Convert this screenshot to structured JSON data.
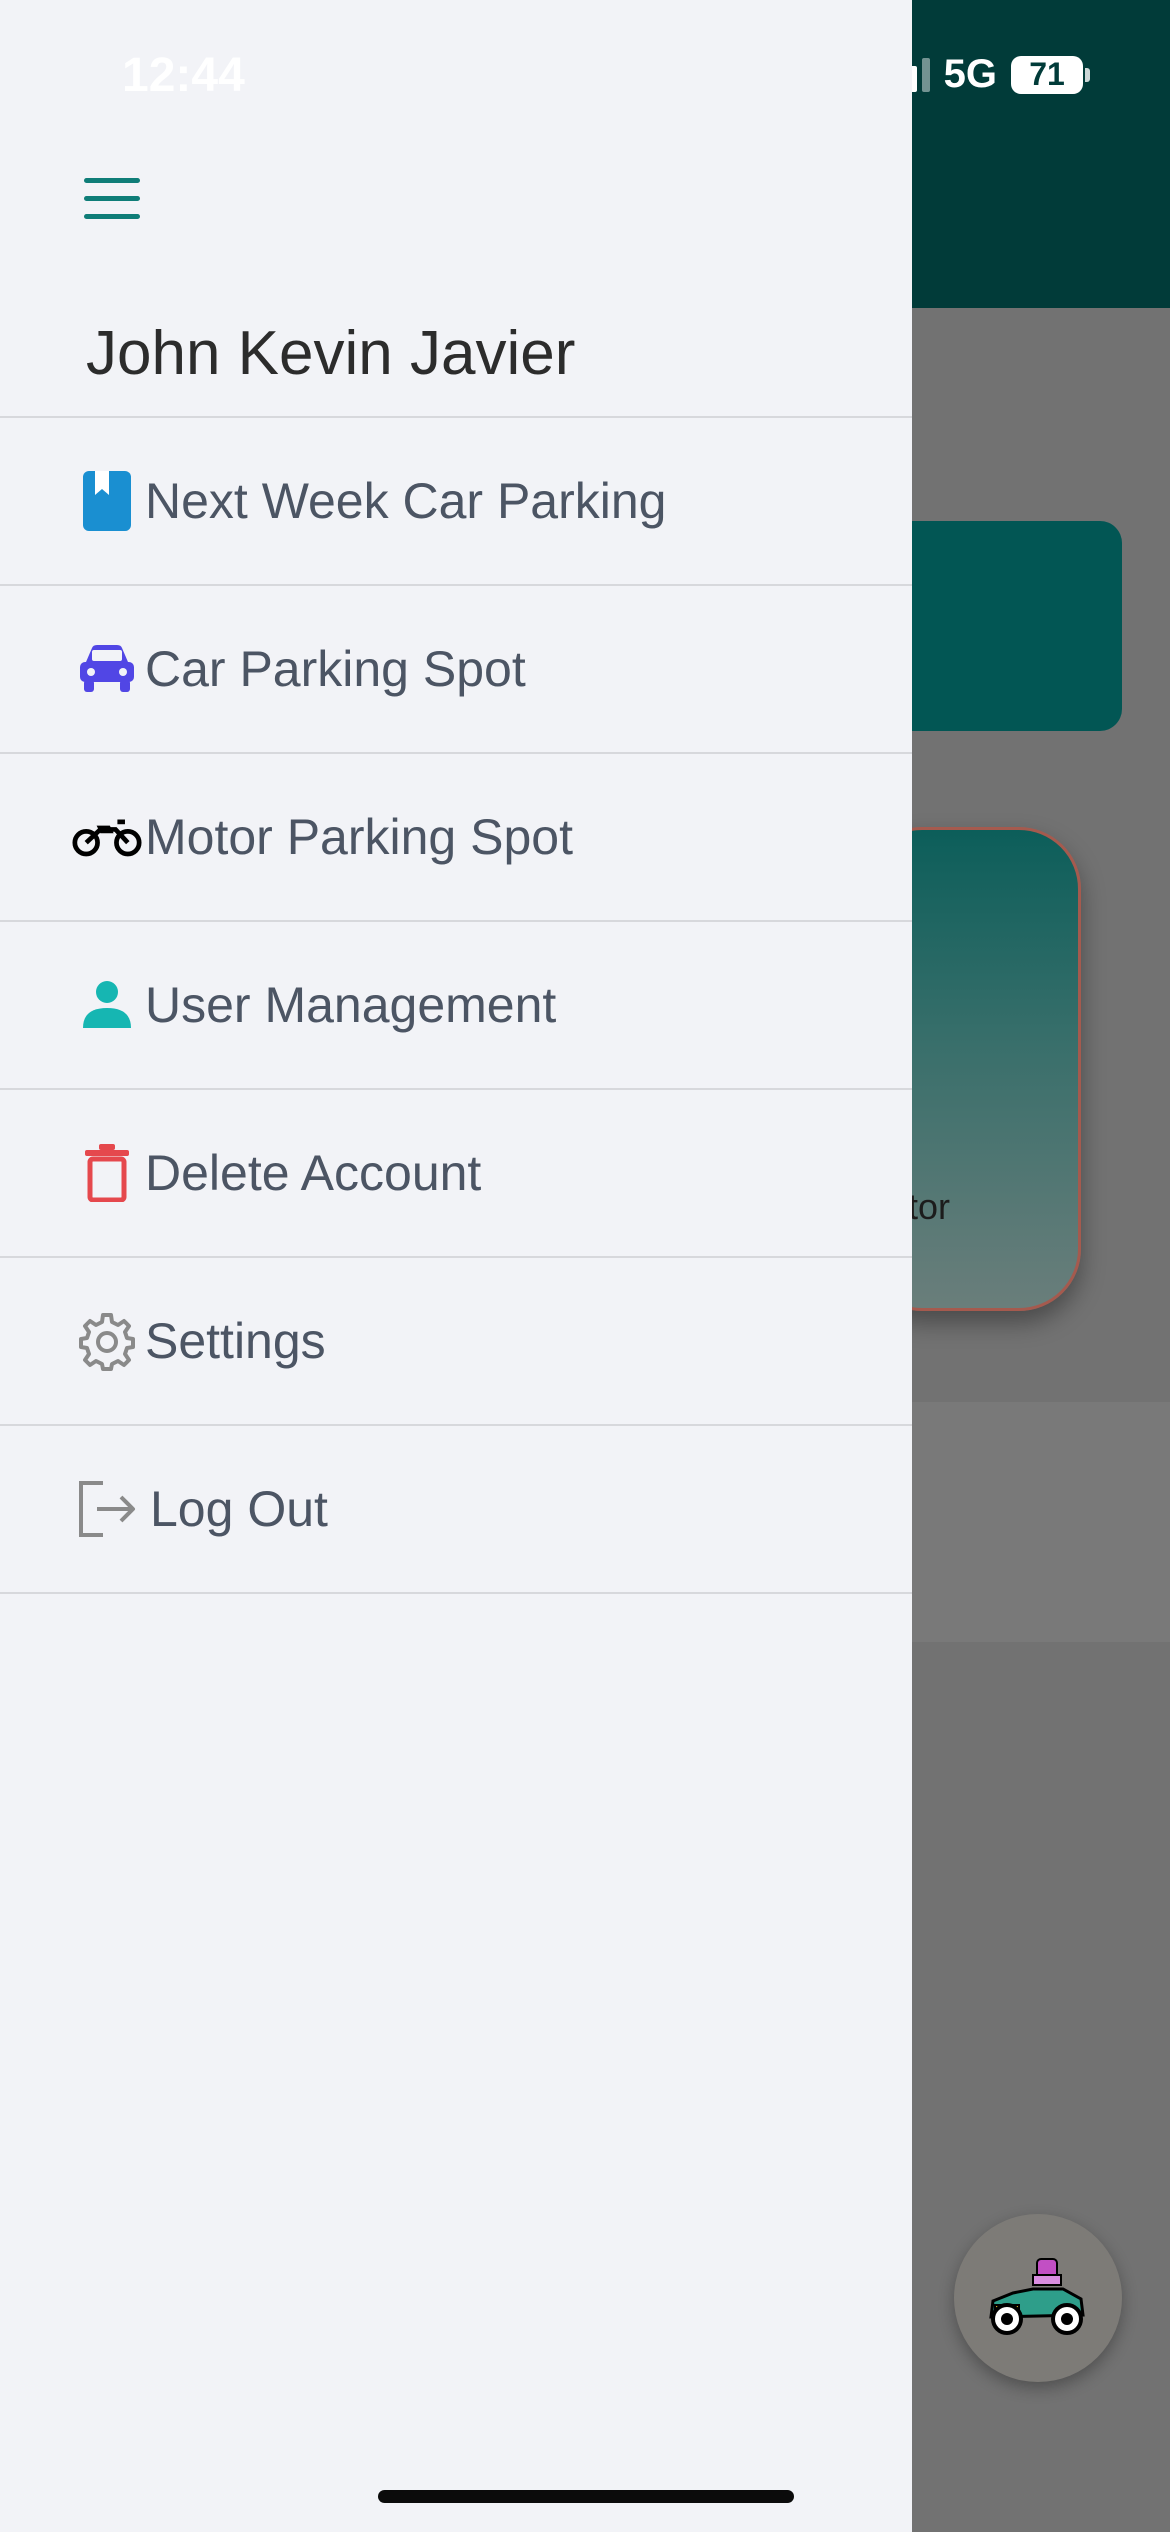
{
  "status_bar": {
    "time": "12:44",
    "network": "5G",
    "battery": "71"
  },
  "drawer": {
    "user_name": "John Kevin Javier",
    "menu": [
      {
        "label": "Next Week Car Parking",
        "icon": "bookmark-icon",
        "color": "#1a8fd1"
      },
      {
        "label": "Car Parking Spot",
        "icon": "car-icon",
        "color": "#5146e5"
      },
      {
        "label": "Motor Parking Spot",
        "icon": "motorcycle-icon",
        "color": "#000000"
      },
      {
        "label": "User Management",
        "icon": "user-icon",
        "color": "#16b6b2"
      },
      {
        "label": "Delete Account",
        "icon": "trash-icon",
        "color": "#e5484d"
      },
      {
        "label": "Settings",
        "icon": "gear-icon",
        "color": "#8a8a8a"
      },
      {
        "label": "Log Out",
        "icon": "logout-icon",
        "color": "#8a8a8a"
      }
    ]
  },
  "background": {
    "card_label": "otor"
  },
  "colors": {
    "header": "#013b39",
    "accent": "#0f7d78",
    "drawer_bg": "#f2f3f7"
  }
}
